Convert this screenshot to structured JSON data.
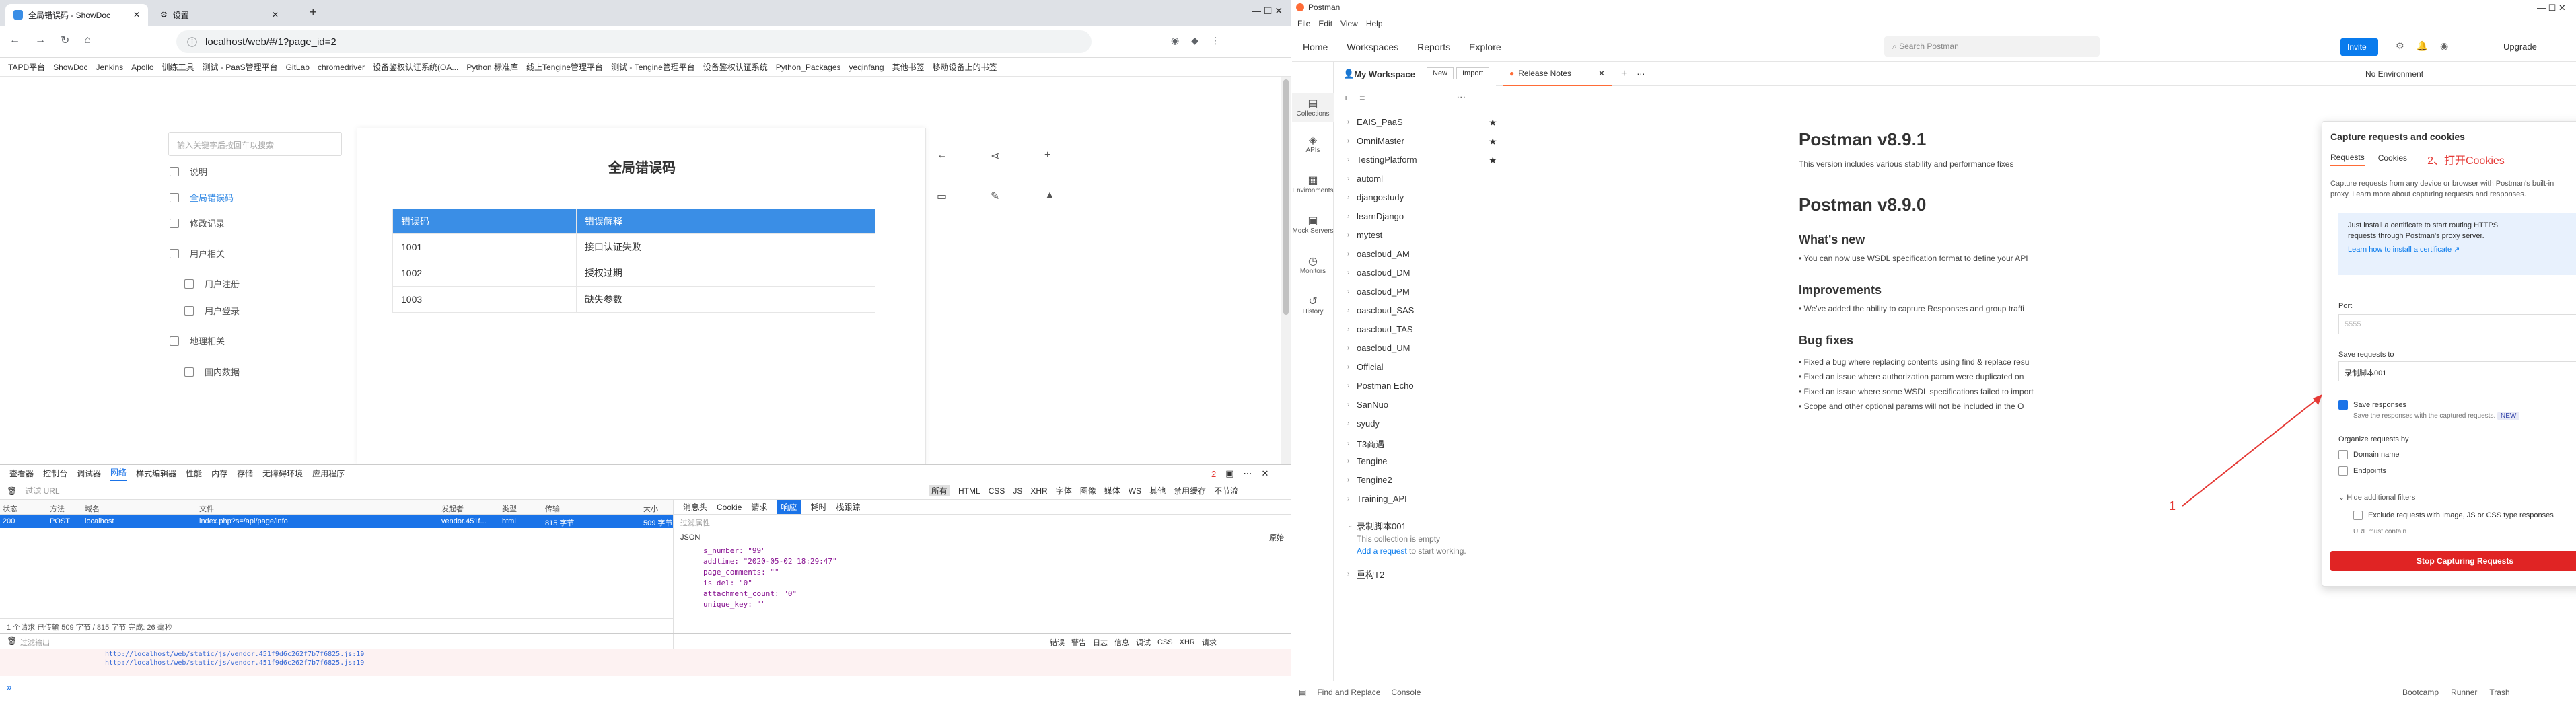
{
  "browser": {
    "tabs": [
      {
        "label": "全局错误码 - ShowDoc"
      },
      {
        "label": "设置"
      }
    ],
    "url": "localhost/web/#/1?page_id=2",
    "bookmarks": [
      "TAPD平台",
      "ShowDoc",
      "Jenkins",
      "Apollo",
      "训练工具",
      "测试 - PaaS管理平台",
      "GitLab",
      "chromedriver",
      "设备鉴权认证系统(OA...",
      "Python 标准库",
      "线上Tengine管理平台",
      "测试 - Tengine管理平台",
      "设备鉴权认证系统",
      "Python_Packages",
      "yeqinfang",
      "其他书签",
      "移动设备上的书签"
    ]
  },
  "showdoc": {
    "search_placeholder": "输入关键字后按回车以搜索",
    "side_items": [
      "说明",
      "全局错误码",
      "修改记录",
      "用户相关",
      "用户注册",
      "用户登录",
      "地理相关",
      "国内数据"
    ],
    "page_title": "全局错误码",
    "table": {
      "headers": [
        "错误码",
        "错误解释"
      ],
      "rows": [
        [
          "1001",
          "接口认证失败"
        ],
        [
          "1002",
          "授权过期"
        ],
        [
          "1003",
          "缺失参数"
        ]
      ]
    }
  },
  "devtools": {
    "tabs": [
      "查看器",
      "控制台",
      "调试器",
      "网络",
      "样式编辑器",
      "性能",
      "内存",
      "存储",
      "无障碍环境",
      "应用程序"
    ],
    "filter_placeholder": "过滤 URL",
    "type_filters": [
      "所有",
      "HTML",
      "CSS",
      "JS",
      "XHR",
      "字体",
      "图像",
      "媒体",
      "WS",
      "其他"
    ],
    "options": [
      "禁用缓存",
      "不节流"
    ],
    "error_count": "2",
    "columns": [
      "状态",
      "方法",
      "域名",
      "文件",
      "发起者",
      "类型",
      "传输",
      "大小"
    ],
    "request": {
      "status": "200",
      "method": "POST",
      "domain": "localhost",
      "file": "index.php?s=/api/page/info",
      "initiator": "vendor.451f...",
      "type": "html",
      "transferred": "815 字节",
      "size": "509 字节"
    },
    "detail_tabs": [
      "消息头",
      "Cookie",
      "请求",
      "响应",
      "耗时",
      "栈跟踪"
    ],
    "detail_filter": "过滤属性",
    "json_label": "JSON",
    "raw_label": "原始",
    "json_lines": [
      "s_number: \"99\"",
      "addtime: \"2020-05-02 18:29:47\"",
      "page_comments: \"\"",
      "is_del: \"0\"",
      "attachment_count: \"0\"",
      "unique_key: \"\""
    ],
    "summary": "1 个请求   已传输 509 字节 / 815 字节   完成: 26 毫秒",
    "console_filter": "过滤输出",
    "console_levels": [
      "错误",
      "警告",
      "日志",
      "信息",
      "调试",
      "CSS",
      "XHR",
      "请求"
    ],
    "console_lines": [
      "http://localhost/web/static/js/vendor.451f9d6c262f7b7f6825.js:19",
      "http://localhost/web/static/js/vendor.451f9d6c262f7b7f6825.js:19"
    ],
    "prompt": "»"
  },
  "postman": {
    "title": "Postman",
    "menu": [
      "File",
      "Edit",
      "View",
      "Help"
    ],
    "nav": [
      "Home",
      "Workspaces",
      "Reports",
      "Explore"
    ],
    "search_placeholder": "Search Postman",
    "invite": "Invite",
    "upgrade": "Upgrade",
    "workspace": "My Workspace",
    "new_btn": "New",
    "import_btn": "Import",
    "open_tab": "Release Notes",
    "env": "No Environment",
    "side_items": [
      "Collections",
      "APIs",
      "Environments",
      "Mock Servers",
      "Monitors",
      "History"
    ],
    "collections": [
      {
        "name": "EAIS_PaaS",
        "star": true
      },
      {
        "name": "OmniMaster",
        "star": true
      },
      {
        "name": "TestingPlatform",
        "star": true
      },
      {
        "name": "automl",
        "star": false
      },
      {
        "name": "djangostudy",
        "star": false
      },
      {
        "name": "learnDjango",
        "star": false
      },
      {
        "name": "mytest",
        "star": false
      },
      {
        "name": "oascloud_AM",
        "star": false
      },
      {
        "name": "oascloud_DM",
        "star": false
      },
      {
        "name": "oascloud_PM",
        "star": false
      },
      {
        "name": "oascloud_SAS",
        "star": false
      },
      {
        "name": "oascloud_TAS",
        "star": false
      },
      {
        "name": "oascloud_UM",
        "star": false
      },
      {
        "name": "Official",
        "star": false
      },
      {
        "name": "Postman Echo",
        "star": false
      },
      {
        "name": "SanNuo",
        "star": false
      },
      {
        "name": "syudy",
        "star": false
      },
      {
        "name": "T3商遇",
        "star": false
      },
      {
        "name": "Tengine",
        "star": false
      },
      {
        "name": "Tengine2",
        "star": false
      },
      {
        "name": "Training_API",
        "star": false
      },
      {
        "name": "录制脚本001",
        "star": false
      },
      {
        "name": "重构T2",
        "star": false
      }
    ],
    "empty_note": "This collection is empty",
    "empty_link": "Add a request",
    "empty_suffix": " to start working.",
    "release": {
      "h1": "Postman v8.9.1",
      "p1": "This version includes various stability and performance fixes",
      "h2": "Postman v8.9.0",
      "h3a": "What's new",
      "b1": "You can now use WSDL specification format to define your API",
      "h3b": "Improvements",
      "b2": "We've added the ability to capture Responses and group traffi",
      "h3c": "Bug fixes",
      "b3": "Fixed a bug where replacing contents using find & replace resu",
      "b4": "Fixed an issue where authorization param were duplicated on",
      "b5": "Fixed an issue where some WSDL specifications failed to import",
      "b6": "Scope and other optional params will not be included in the O"
    },
    "capture": {
      "title": "Capture requests and cookies",
      "tabs": [
        "Requests",
        "Cookies"
      ],
      "desc1": "Capture requests from any device or browser with Postman's built-in",
      "desc2": "proxy. Learn more about capturing requests and responses.",
      "info1": "Just install a certificate to start routing HTTPS",
      "info2": "requests through Postman's proxy server.",
      "info_link": "Learn how to install a certificate ↗",
      "port_label": "Port",
      "port_value": "5555",
      "save_to_label": "Save requests to",
      "save_to_value": "录制脚本001",
      "save_responses": "Save responses",
      "save_responses_sub": "Save the responses with the captured requests.",
      "new_badge": "NEW",
      "organize": "Organize requests by",
      "org1": "Domain name",
      "org2": "Endpoints",
      "hide_filters": "Hide additional filters",
      "exclude": "Exclude requests with Image, JS or CSS type responses",
      "url_label": "URL must contain",
      "stop": "Stop Capturing Requests"
    },
    "annotations": {
      "a1": "1",
      "a2": "2、打开Cookies"
    },
    "footer": [
      "Find and Replace",
      "Console",
      "Bootcamp",
      "Runner",
      "Trash"
    ]
  },
  "colors": {
    "accent": "#1a73e8",
    "pm_orange": "#ff6c37",
    "stop_red": "#e02424",
    "annotation": "#e53935",
    "table_head": "#3a8ee6"
  }
}
